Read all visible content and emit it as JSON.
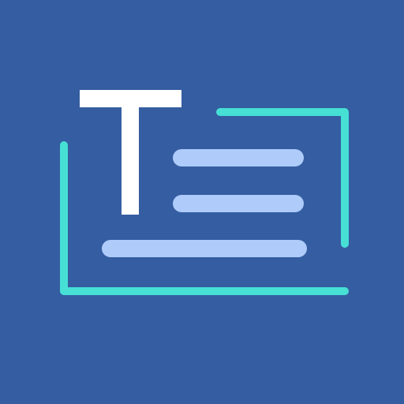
{
  "icon": {
    "name": "text-scanner-app-icon",
    "glyph": "T",
    "colors": {
      "background": "#355DA1",
      "glyph": "#FFFFFF",
      "text_lines": "#AECBFA",
      "frame": "#46E0D5"
    }
  }
}
